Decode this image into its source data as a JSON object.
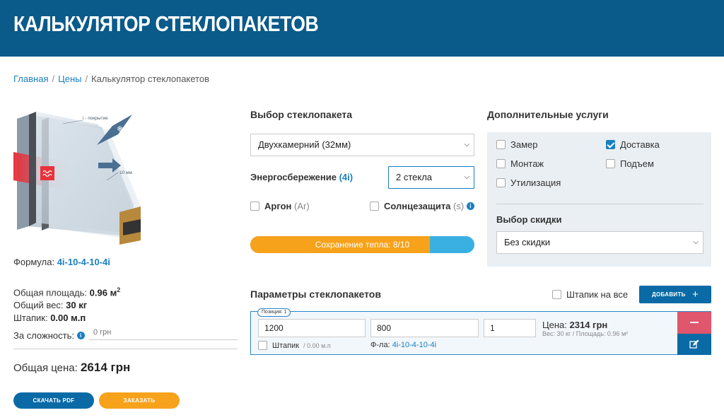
{
  "header": {
    "title": "КАЛЬКУЛЯТОР СТЕКЛОПАКЕТОВ"
  },
  "breadcrumb": {
    "home": "Главная",
    "prices": "Цены",
    "current": "Калькулятор стеклопакетов",
    "separator": "/"
  },
  "image": {
    "coating_label": "i - покрытие",
    "gap_label": "10 мм",
    "heat_icon": "heat-waves-icon",
    "snow_icon": "snowflake-icon"
  },
  "summary": {
    "formula_label": "Формула:",
    "formula_value": "4i-10-4-10-4i",
    "area_label": "Общая площадь:",
    "area_value": "0.96 м",
    "area_unit_sup": "2",
    "weight_label": "Общий вес:",
    "weight_value": "30 кг",
    "shtapik_label": "Штапик:",
    "shtapik_value": "0.00 м.п",
    "complexity_label": "За сложность:",
    "complexity_placeholder": "0 грн",
    "total_label": "Общая цена:",
    "total_value": "2614 грн"
  },
  "buttons": {
    "pdf": "СКАЧАТЬ PDF",
    "order": "ЗАКАЗАТЬ",
    "add": "ДОБАВИТЬ"
  },
  "selection": {
    "title": "Выбор стеклопакета",
    "package_value": "Двухкамерний (32мм)",
    "energy_label": "Энергосбережение",
    "energy_suffix": "(4i)",
    "glass_count_value": "2 стекла",
    "argon_label": "Аргон",
    "argon_suffix": "(Ar)",
    "sun_label": "Солнцезащита",
    "sun_suffix": "(s)",
    "heat_progress_label": "Сохранение тепла: 8/10",
    "heat_progress_value": 0.8
  },
  "services": {
    "title": "Дополнительные услуги",
    "items": [
      {
        "label": "Замер",
        "checked": false
      },
      {
        "label": "Доставка",
        "checked": true
      },
      {
        "label": "Монтаж",
        "checked": false
      },
      {
        "label": "Подъем",
        "checked": false
      },
      {
        "label": "Утилизация",
        "checked": false
      }
    ],
    "discount_title": "Выбор скидки",
    "discount_value": "Без скидки"
  },
  "params": {
    "title": "Параметры стеклопакетов",
    "shtapik_all_label": "Штапик на все",
    "position_tag": "Позиция: 1",
    "width": "1200",
    "height": "800",
    "quantity": "1",
    "shtapik_label": "Штапик",
    "shtapik_value": "/ 0.00 м.п",
    "formula_label": "Ф-ла:",
    "formula_value": "4i-10-4-10-4i",
    "price_label": "Цена:",
    "price_value": "2314 грн",
    "details": "Вес: 30 кг / Площадь: 0.96 м²"
  },
  "colors": {
    "header": "#0a5a8a",
    "accent_blue": "#1a7fc1",
    "orange": "#f7a21b",
    "light_blue": "#3ab0e2",
    "red": "#e0566d"
  }
}
